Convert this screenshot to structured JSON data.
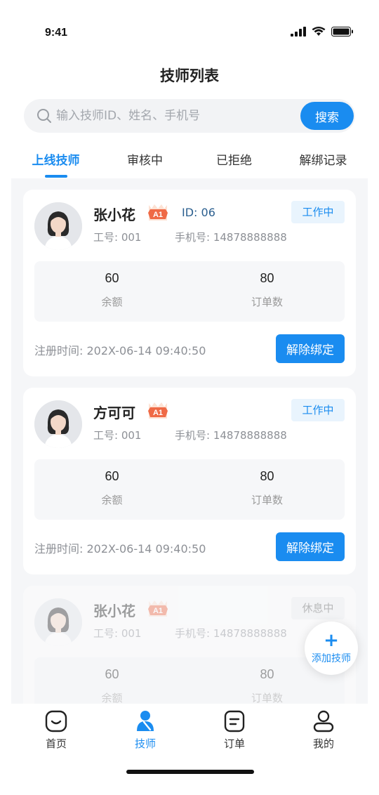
{
  "status_bar": {
    "time": "9:41"
  },
  "header": {
    "title": "技师列表"
  },
  "search": {
    "placeholder": "输入技师ID、姓名、手机号",
    "value": "",
    "button_label": "搜索"
  },
  "tabs": [
    {
      "label": "上线技师",
      "active": true
    },
    {
      "label": "审核中",
      "active": false
    },
    {
      "label": "已拒绝",
      "active": false
    },
    {
      "label": "解绑记录",
      "active": false
    }
  ],
  "technicians": [
    {
      "name": "张小花",
      "level": "A1",
      "id_text": "ID: 06",
      "status": "工作中",
      "work_no": "工号: 001",
      "phone": "手机号: 14878888888",
      "balance": "60",
      "balance_label": "余额",
      "orders": "80",
      "orders_label": "订单数",
      "reg_time": "注册时间:  202X-06-14 09:40:50",
      "action": "解除绑定"
    },
    {
      "name": "方可可",
      "level": "A1",
      "id_text": "",
      "status": "工作中",
      "work_no": "工号: 001",
      "phone": "手机号: 14878888888",
      "balance": "60",
      "balance_label": "余额",
      "orders": "80",
      "orders_label": "订单数",
      "reg_time": "注册时间:  202X-06-14 09:40:50",
      "action": "解除绑定"
    },
    {
      "name": "张小花",
      "level": "A1",
      "id_text": "",
      "status": "休息中",
      "work_no": "工号: 001",
      "phone": "手机号: 14878888888",
      "balance": "60",
      "balance_label": "余额",
      "orders": "80",
      "orders_label": "订单数"
    }
  ],
  "fab": {
    "icon": "plus-icon",
    "label": "添加技师"
  },
  "tabbar": [
    {
      "label": "首页",
      "icon": "home-icon",
      "active": false
    },
    {
      "label": "技师",
      "icon": "technician-icon",
      "active": true
    },
    {
      "label": "订单",
      "icon": "order-icon",
      "active": false
    },
    {
      "label": "我的",
      "icon": "profile-icon",
      "active": false
    }
  ],
  "colors": {
    "accent": "#1a8cf0",
    "background": "#f5f6f8",
    "status_rest": "#eeeff1"
  }
}
